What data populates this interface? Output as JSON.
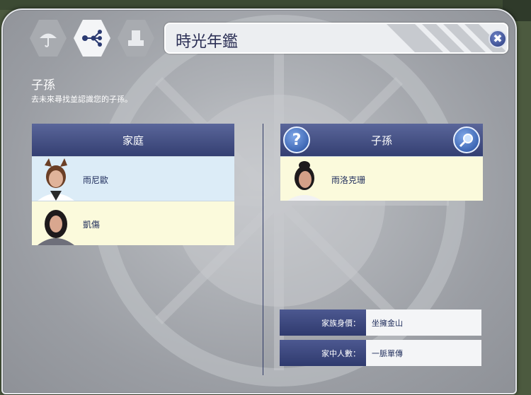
{
  "window": {
    "title": "時光年鑑",
    "close_label": "✖",
    "tabs": [
      {
        "icon": "umbrella-icon"
      },
      {
        "icon": "family-tree-icon",
        "active": true
      },
      {
        "icon": "podium-icon"
      }
    ]
  },
  "section": {
    "title": "子孫",
    "description": "去未來尋找並認識您的子孫。"
  },
  "family": {
    "header": "家庭",
    "members": [
      {
        "name": "雨尼歐",
        "portrait": "catgirl-portrait-icon"
      },
      {
        "name": "凱傷",
        "portrait": "longhair-man-portrait-icon"
      }
    ]
  },
  "descendants": {
    "header": "子孫",
    "help_label": "?",
    "members": [
      {
        "name": "雨洛克珊",
        "portrait": "woman-portrait-icon"
      }
    ]
  },
  "stats": [
    {
      "label": "家族身價：",
      "value": "坐擁金山"
    },
    {
      "label": "家中人數：",
      "value": "一脈單傳"
    }
  ],
  "colors": {
    "accent_navy": "#343f72",
    "row_blue": "#dcecf7",
    "row_yellow": "#fbfadc"
  }
}
